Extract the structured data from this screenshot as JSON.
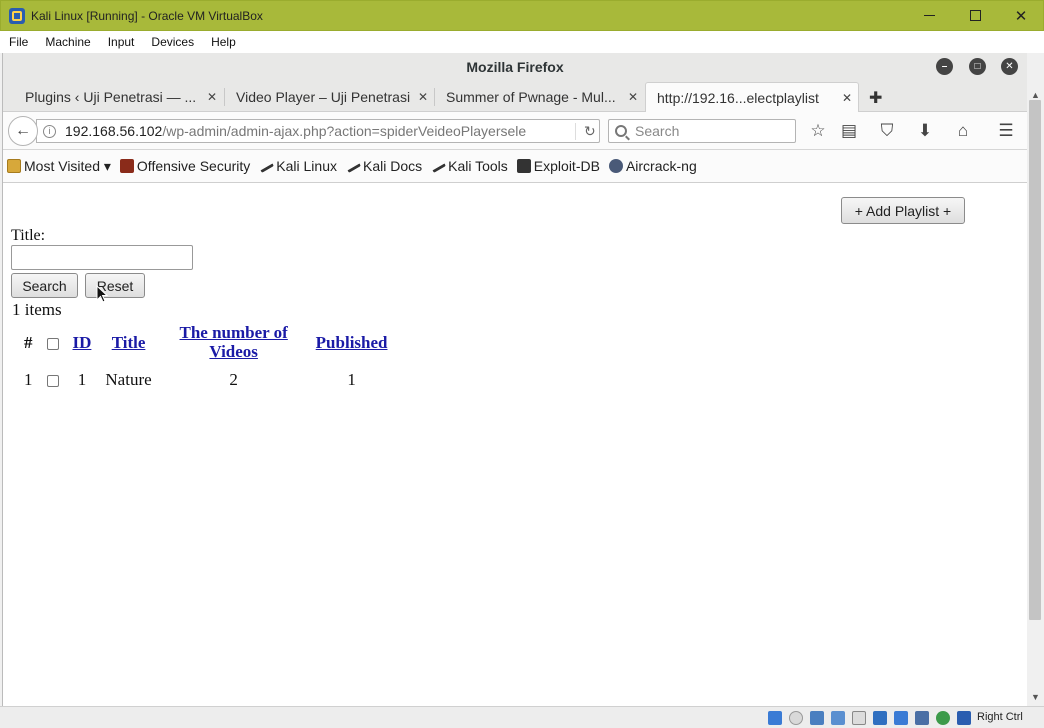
{
  "host": {
    "title": "Kali Linux [Running] - Oracle VM VirtualBox",
    "menu": [
      "File",
      "Machine",
      "Input",
      "Devices",
      "Help"
    ],
    "host_key": "Right Ctrl"
  },
  "browser": {
    "window_title": "Mozilla Firefox",
    "tabs": [
      {
        "label": "Plugins ‹ Uji Penetrasi — ..."
      },
      {
        "label": "Video Player – Uji Penetrasi"
      },
      {
        "label": "Summer of Pwnage - Mul..."
      },
      {
        "label": "http://192.16...electplaylist"
      }
    ],
    "url_host": "192.168.56.102",
    "url_path": "/wp-admin/admin-ajax.php?action=spiderVeideoPlayersele",
    "search_placeholder": "Search",
    "bookmarks": [
      {
        "label": "Most Visited ▾",
        "icon": "folder-icon"
      },
      {
        "label": "Offensive Security",
        "icon": "offsec-icon"
      },
      {
        "label": "Kali Linux",
        "icon": "kali-icon"
      },
      {
        "label": "Kali Docs",
        "icon": "kali-icon"
      },
      {
        "label": "Kali Tools",
        "icon": "kali-icon"
      },
      {
        "label": "Exploit-DB",
        "icon": "exploitdb-icon"
      },
      {
        "label": "Aircrack-ng",
        "icon": "aircrack-icon"
      }
    ]
  },
  "page": {
    "add_playlist": "+ Add Playlist +",
    "title_label": "Title:",
    "title_value": "",
    "search_button": "Search",
    "reset_button": "Reset",
    "items_count": "1 items",
    "table": {
      "headers": [
        "#",
        "",
        "ID",
        "Title",
        "The number of Videos",
        "Published"
      ],
      "rows": [
        {
          "num": "1",
          "id": "1",
          "title": "Nature",
          "videos": "2",
          "published": "1"
        }
      ]
    }
  },
  "colors": {
    "host_titlebar": "#a8b93a",
    "link": "#1a1aa6"
  }
}
